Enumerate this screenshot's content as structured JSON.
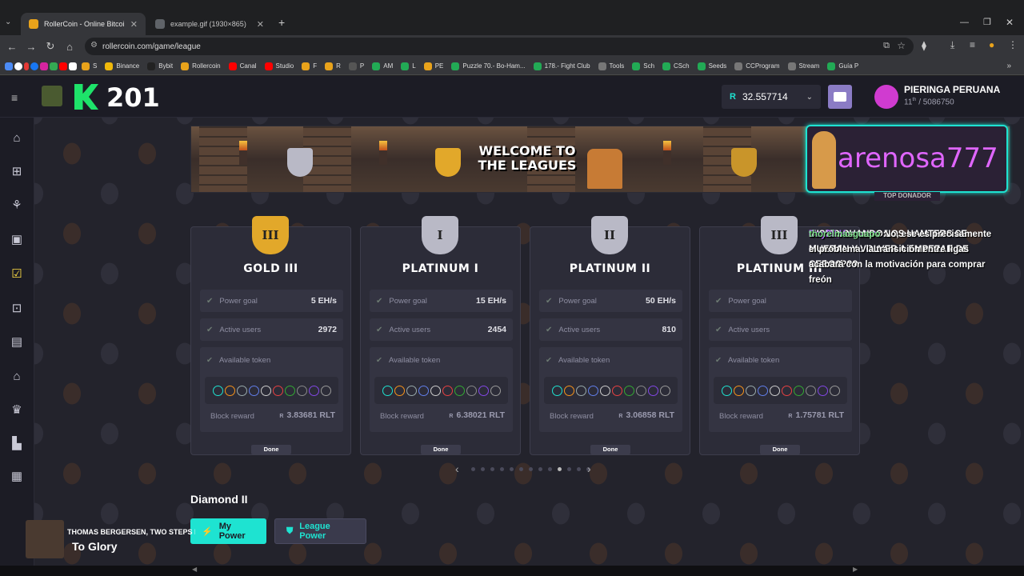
{
  "browser": {
    "tabs": [
      {
        "title": "RollerCoin - Online Bitcoin Minin",
        "active": true
      },
      {
        "title": "example.gif (1930×865)",
        "active": false
      }
    ],
    "new_tab": "+",
    "url": "rollercoin.com/game/league",
    "bookmarks": [
      "S",
      "Binance",
      "Bybit",
      "Rollercoin",
      "Canal",
      "Studio",
      "F",
      "R",
      "P",
      "AM",
      "L",
      "PE",
      "Puzzle 70.- Bo-Ham...",
      "178.- Fight Club",
      "Tools",
      "Sch",
      "CSch",
      "Seeds",
      "CCProgram",
      "Stream",
      "Guía P"
    ]
  },
  "header": {
    "level": "201",
    "balance_currency": "R",
    "balance": "32.557714",
    "username": "PIERINGA PERUANA",
    "rank": "11",
    "rank_suffix": "th",
    "rank_total": "/ 5086750"
  },
  "banner": {
    "line1": "WELCOME TO",
    "line2": "THE LEAGUES"
  },
  "donor": {
    "name": "arenosa777",
    "label": "TOP DONADOR"
  },
  "labels": {
    "power_goal": "Power goal",
    "active_users": "Active users",
    "available_token": "Available token",
    "block_reward": "Block reward",
    "done": "Done",
    "reward_currency": "R"
  },
  "leagues": [
    {
      "name": "GOLD III",
      "badge": "III",
      "power_goal": "5 EH/s",
      "active_users": "2972",
      "block_reward": "3.83681 RLT",
      "color": "#e2a82a"
    },
    {
      "name": "PLATINUM I",
      "badge": "I",
      "power_goal": "15 EH/s",
      "active_users": "2454",
      "block_reward": "6.38021 RLT",
      "color": "#b9b9c6"
    },
    {
      "name": "PLATINUM II",
      "badge": "II",
      "power_goal": "50 EH/s",
      "active_users": "810",
      "block_reward": "3.06858 RLT",
      "color": "#b9b9c6"
    },
    {
      "name": "PLATINUM III",
      "badge": "III",
      "power_goal": "",
      "active_users": "",
      "block_reward": "1.75781 RLT",
      "color": "#b9b9c6"
    }
  ],
  "token_strip": "R B L S ✕ D V ≡ NHT",
  "carousel": {
    "prev": "‹",
    "next": "›",
    "count": 13,
    "active": 9
  },
  "chat": [
    {
      "user": "",
      "text": "MISMO CUANDO LOS HAMTERS SE MUERAN Y VOLVER A EMPEZAR DE CERO????"
    },
    {
      "user": "Uncle_Hamster",
      "text": ": No, ese es precisamente el problema: la transición entre ligas acabará con la motivación para comprar freón"
    },
    {
      "user": "Cuy28",
      "text": ": oe ctm"
    },
    {
      "user": "Cuy28",
      "text": ":"
    },
    {
      "user": "thorelmasguapo",
      "text": ":"
    }
  ],
  "section_title": "Diamond II",
  "buttons": {
    "my_power": "My Power",
    "league_power": "League Power"
  },
  "music": {
    "artist": "THOMAS BERGERSEN, TWO STEPS FR",
    "track": "To Glory"
  },
  "colors": {
    "accent": "#1ee3d1",
    "gold": "#e2a82a",
    "purple": "#b96bff",
    "card": "#2c2c38"
  }
}
